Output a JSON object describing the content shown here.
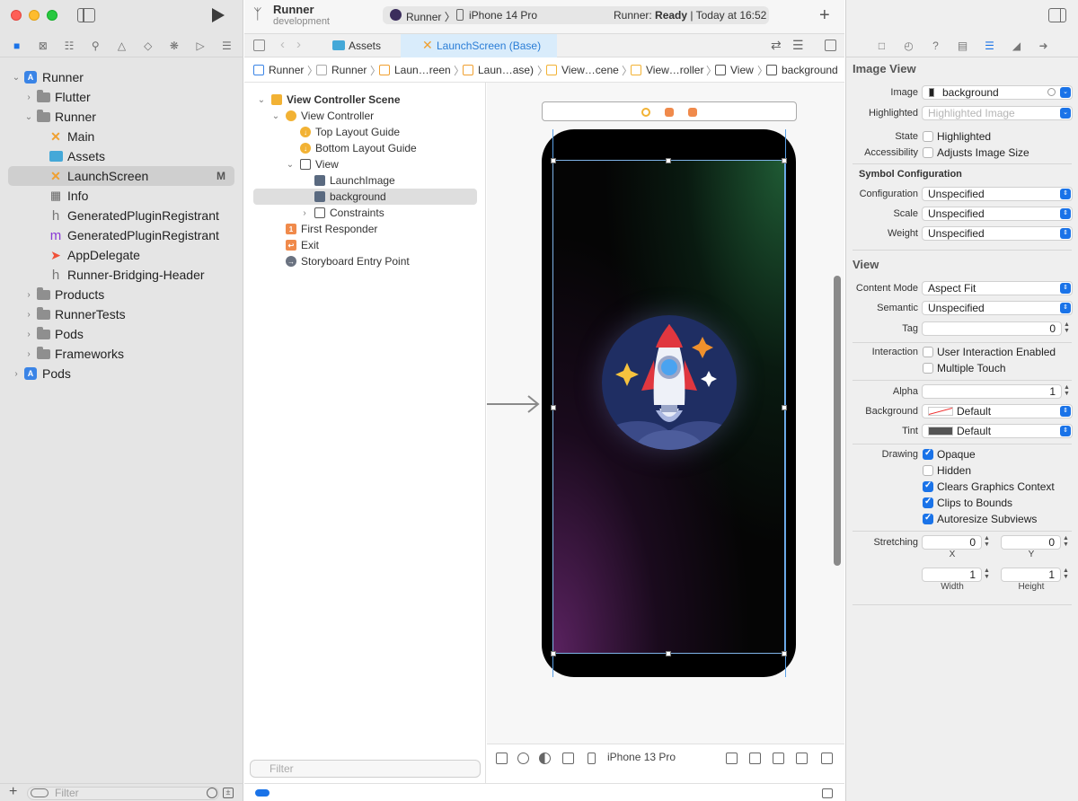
{
  "navigator": {
    "tree": [
      {
        "label": "Runner",
        "indent": 0,
        "kind": "project",
        "expanded": true
      },
      {
        "label": "Flutter",
        "indent": 1,
        "kind": "folder",
        "expanded": false
      },
      {
        "label": "Runner",
        "indent": 1,
        "kind": "folder",
        "expanded": true
      },
      {
        "label": "Main",
        "indent": 2,
        "kind": "storyboard"
      },
      {
        "label": "Assets",
        "indent": 2,
        "kind": "assets"
      },
      {
        "label": "LaunchScreen",
        "indent": 2,
        "kind": "storyboard",
        "selected": true,
        "badge": "M"
      },
      {
        "label": "Info",
        "indent": 2,
        "kind": "plist"
      },
      {
        "label": "GeneratedPluginRegistrant",
        "indent": 2,
        "kind": "h"
      },
      {
        "label": "GeneratedPluginRegistrant",
        "indent": 2,
        "kind": "m"
      },
      {
        "label": "AppDelegate",
        "indent": 2,
        "kind": "swift"
      },
      {
        "label": "Runner-Bridging-Header",
        "indent": 2,
        "kind": "h"
      },
      {
        "label": "Products",
        "indent": 1,
        "kind": "folder",
        "expanded": false
      },
      {
        "label": "RunnerTests",
        "indent": 1,
        "kind": "folder",
        "expanded": false
      },
      {
        "label": "Pods",
        "indent": 1,
        "kind": "folder",
        "expanded": false
      },
      {
        "label": "Frameworks",
        "indent": 1,
        "kind": "folder",
        "expanded": false
      },
      {
        "label": "Pods",
        "indent": 0,
        "kind": "project",
        "expanded": false
      }
    ],
    "filter_placeholder": "Filter"
  },
  "toolbar": {
    "scheme": "Runner",
    "branch": "development",
    "target": "Runner",
    "device": "iPhone 14 Pro",
    "status_prefix": "Runner: ",
    "status_state": "Ready",
    "status_time": " | Today at 16:52"
  },
  "tabs": {
    "assets": "Assets",
    "launch": "LaunchScreen (Base)"
  },
  "jumpbar": [
    "Runner",
    "Runner",
    "Laun…reen",
    "Laun…ase)",
    "View…cene",
    "View…roller",
    "View",
    "background"
  ],
  "outline": {
    "rows": [
      {
        "label": "View Controller Scene",
        "indent": 0,
        "icon": "scene",
        "bold": true
      },
      {
        "label": "View Controller",
        "indent": 1,
        "icon": "vc"
      },
      {
        "label": "Top Layout Guide",
        "indent": 2,
        "icon": "guide"
      },
      {
        "label": "Bottom Layout Guide",
        "indent": 2,
        "icon": "guide"
      },
      {
        "label": "View",
        "indent": 2,
        "icon": "view"
      },
      {
        "label": "LaunchImage",
        "indent": 3,
        "icon": "image"
      },
      {
        "label": "background",
        "indent": 3,
        "icon": "image",
        "selected": true
      },
      {
        "label": "Constraints",
        "indent": 3,
        "icon": "constraints"
      },
      {
        "label": "First Responder",
        "indent": 1,
        "icon": "responder"
      },
      {
        "label": "Exit",
        "indent": 1,
        "icon": "exit"
      },
      {
        "label": "Storyboard Entry Point",
        "indent": 1,
        "icon": "entry"
      }
    ],
    "filter_placeholder": "Filter"
  },
  "canvas": {
    "device_config": "iPhone 13 Pro"
  },
  "inspector": {
    "image_view_title": "Image View",
    "image_label": "Image",
    "image_value": "background",
    "highlighted_label": "Highlighted",
    "highlighted_placeholder": "Highlighted Image",
    "state_label": "State",
    "state_option": "Highlighted",
    "accessibility_label": "Accessibility",
    "accessibility_option": "Adjusts Image Size",
    "symbol_title": "Symbol Configuration",
    "configuration_label": "Configuration",
    "configuration_value": "Unspecified",
    "scale_label": "Scale",
    "scale_value": "Unspecified",
    "weight_label": "Weight",
    "weight_value": "Unspecified",
    "view_title": "View",
    "content_mode_label": "Content Mode",
    "content_mode_value": "Aspect Fit",
    "semantic_label": "Semantic",
    "semantic_value": "Unspecified",
    "tag_label": "Tag",
    "tag_value": "0",
    "interaction_label": "Interaction",
    "user_interaction": "User Interaction Enabled",
    "multiple_touch": "Multiple Touch",
    "alpha_label": "Alpha",
    "alpha_value": "1",
    "background_label": "Background",
    "background_value": "Default",
    "tint_label": "Tint",
    "tint_value": "Default",
    "drawing_label": "Drawing",
    "opaque": "Opaque",
    "hidden": "Hidden",
    "clears": "Clears Graphics Context",
    "clips": "Clips to Bounds",
    "autoresize": "Autoresize Subviews",
    "stretching_label": "Stretching",
    "stretch_x": "0",
    "stretch_y": "0",
    "stretch_w": "1",
    "stretch_h": "1",
    "x_caption": "X",
    "y_caption": "Y",
    "width_caption": "Width",
    "height_caption": "Height",
    "checkbox_states": {
      "highlighted": false,
      "adjusts": false,
      "user_interaction": false,
      "multiple_touch": false,
      "opaque": true,
      "hidden": false,
      "clears": true,
      "clips": true,
      "autoresize": true
    }
  },
  "colors": {
    "accent": "#1a73e8",
    "selection_tab": "#d9ecfb",
    "rocket_badge": "#1f2e63"
  }
}
